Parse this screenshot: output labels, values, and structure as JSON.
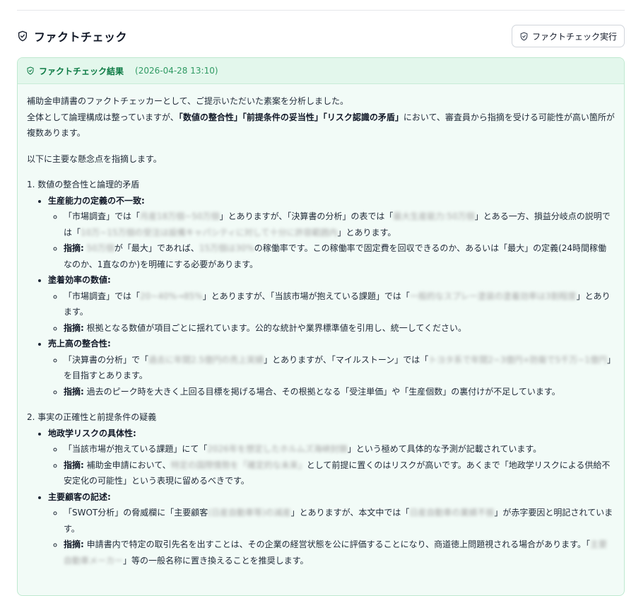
{
  "section": {
    "title": "ファクトチェック",
    "run_button": "ファクトチェック実行"
  },
  "result": {
    "title": "ファクトチェック結果",
    "timestamp": "(2026-04-28 13:10)"
  },
  "intro": {
    "line1": "補助金申請書のファクトチェッカーとして、ご提示いただいた素案を分析しました。",
    "line2_a": "全体として論理構成は整っていますが、",
    "line2_b": "「数値の整合性」「前提条件の妥当性」「リスク認識の矛盾」",
    "line2_c": "において、審査員から指摘を受ける可能性が高い箇所が複数あります。",
    "line3": "以下に主要な懸念点を指摘します。"
  },
  "s1": {
    "heading": "1. 数値の整合性と論理的矛盾",
    "a_title": "生産能力の定義の不一致:",
    "a1": {
      "t1": "「市場調査」では「",
      "b1": "月産18万個~50万個",
      "t2": "」とありますが、「決算書の分析」の表では「",
      "b2": "最大生産能力:50万個",
      "t3": "」とある一方、損益分岐点の説明では「",
      "b3": "10万~15万個の受注は設備キャパシティに対して十分に許容範囲内",
      "t4": "」とあります。"
    },
    "a2": {
      "label": "指摘:",
      "b1": "50万個",
      "t1": "が「最大」であれば、",
      "b2": "15万個は30%",
      "t2": "の稼働率です。この稼働率で固定費を回収できるのか、あるいは「最大」の定義(24時間稼働なのか、1直なのか)を明確にする必要があります。"
    },
    "b_title": "塗着効率の数値:",
    "b1": {
      "t1": "「市場調査」では「",
      "b1": "20~40%→85%",
      "t2": "」とありますが、「当該市場が抱えている課題」では「",
      "b2": "一般的なスプレー塗装の塗着効率は3割程度",
      "t3": "」とあります。"
    },
    "b2": {
      "label": "指摘:",
      "t1": "根拠となる数値が項目ごとに揺れています。公的な統計や業界標準値を引用し、統一してください。"
    },
    "c_title": "売上高の整合性:",
    "c1": {
      "t1": "「決算書の分析」で「",
      "b1": "過去に年間2.5億円の売上実績",
      "t2": "」とありますが、「マイルストーン」では「",
      "b2": "トヨタ系で年間2~3億円+防衛で5千万~1億円",
      "t3": "」を目指すとあります。"
    },
    "c2": {
      "label": "指摘:",
      "t1": "過去のピーク時を大きく上回る目標を掲げる場合、その根拠となる「受注単価」や「生産個数」の裏付けが不足しています。"
    }
  },
  "s2": {
    "heading": "2. 事実の正確性と前提条件の疑義",
    "a_title": "地政学リスクの具体性:",
    "a1": {
      "t1": "「当該市場が抱えている課題」にて「",
      "b1": "2026年を想定したホルムズ海峡封鎖",
      "t2": "」という極めて具体的な予測が記載されています。"
    },
    "a2": {
      "label": "指摘:",
      "t1": "補助金申請において、",
      "b1": "特定の国際情勢を「確定的な未来」",
      "t2": "として前提に置くのはリスクが高いです。あくまで「地政学リスクによる供給不安定化の可能性」という表現に留めるべきです。"
    },
    "b_title": "主要顧客の記述:",
    "b1": {
      "t1": "「SWOT分析」の脅威欄に「主要顧客",
      "b1": "(日産自動車等)の減産",
      "t2": "」とありますが、本文中では「",
      "b2": "日産自動車の業績不振",
      "t3": "」が赤字要因と明記されています。"
    },
    "b2": {
      "label": "指摘:",
      "t1": "申請書内で特定の取引先名を出すことは、その企業の経営状態を公に評価することになり、商道徳上問題視される場合があります。「",
      "b1": "主要自動車メーカー",
      "t2": "」等の一般名称に置き換えることを推奨します。"
    }
  }
}
